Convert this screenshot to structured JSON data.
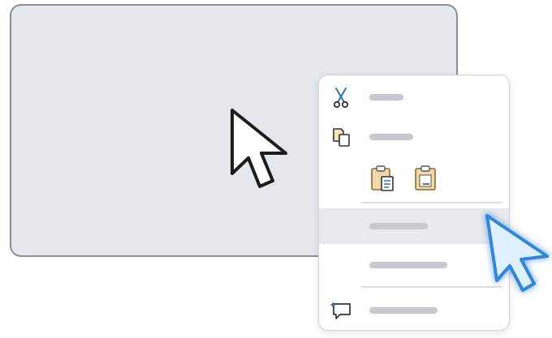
{
  "window": {
    "background": "#e4e7ec",
    "border": "#8a8f96"
  },
  "pointer": {
    "icon": "arrow-cursor-icon"
  },
  "context_menu": {
    "items": [
      {
        "id": "cut",
        "icon": "scissors-icon",
        "label": ""
      },
      {
        "id": "copy",
        "icon": "copy-icon",
        "label": ""
      },
      {
        "id": "paste_options",
        "icons": [
          "paste-icon",
          "paste-text-only-icon"
        ]
      },
      {
        "id": "item4",
        "label": "",
        "state": "hovered"
      },
      {
        "id": "item5",
        "label": ""
      },
      {
        "id": "comment",
        "icon": "comment-icon",
        "label": ""
      }
    ],
    "hover_color": "#e7e9ec"
  },
  "highlight_cursor": {
    "icon": "arrow-cursor-icon",
    "color": "#3b8ee8"
  }
}
